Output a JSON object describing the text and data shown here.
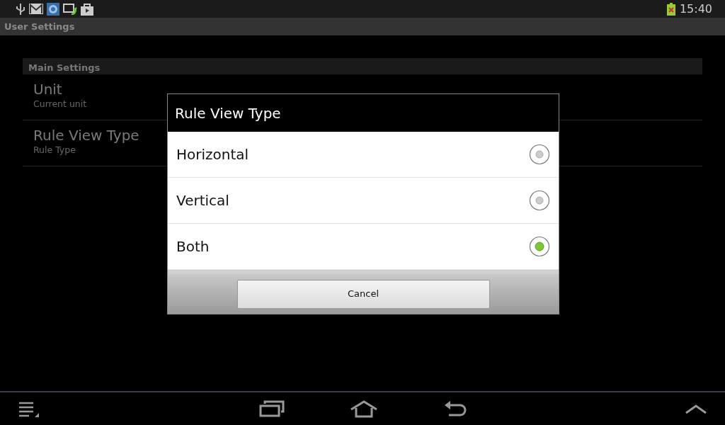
{
  "status_bar": {
    "time": "15:40"
  },
  "title_bar": {
    "title": "User Settings"
  },
  "settings": {
    "section": "Main Settings",
    "items": [
      {
        "title": "Unit",
        "summary": "Current unit"
      },
      {
        "title": "Rule View Type",
        "summary": "Rule Type"
      }
    ]
  },
  "dialog": {
    "title": "Rule View Type",
    "options": [
      {
        "label": "Horizontal",
        "selected": false
      },
      {
        "label": "Vertical",
        "selected": false
      },
      {
        "label": "Both",
        "selected": true
      }
    ],
    "buttons": [
      "Cancel"
    ]
  }
}
